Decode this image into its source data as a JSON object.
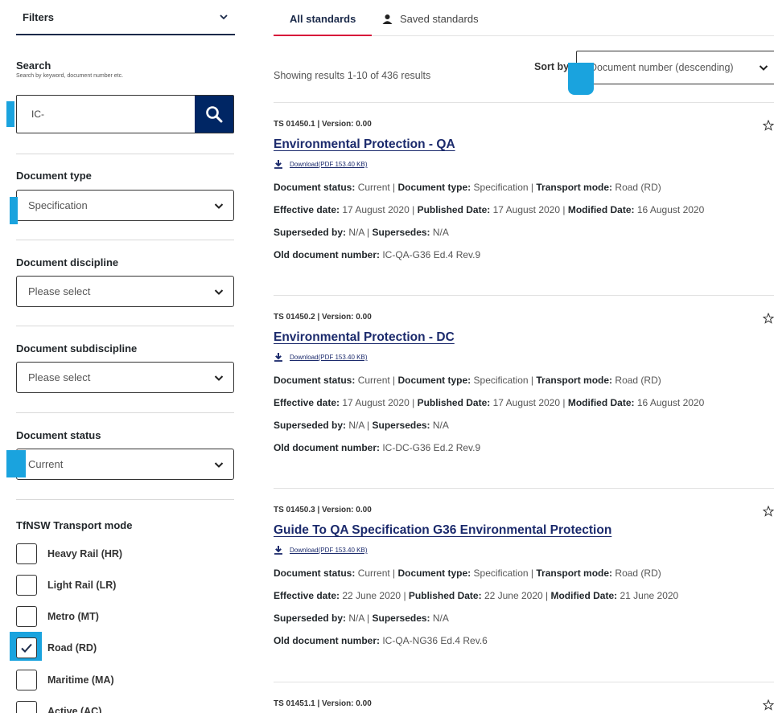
{
  "sidebar": {
    "filters_title": "Filters",
    "search": {
      "label": "Search",
      "hint": "Search by keyword, document number etc.",
      "value": "IC-"
    },
    "document_type": {
      "label": "Document type",
      "value": "Specification"
    },
    "document_discipline": {
      "label": "Document discipline",
      "value": "Please select"
    },
    "document_subdiscipline": {
      "label": "Document subdiscipline",
      "value": "Please select"
    },
    "document_status": {
      "label": "Document status",
      "value": "Current"
    },
    "transport_mode": {
      "label": "TfNSW Transport mode",
      "options": [
        {
          "label": "Heavy Rail (HR)",
          "checked": false
        },
        {
          "label": "Light Rail (LR)",
          "checked": false
        },
        {
          "label": "Metro (MT)",
          "checked": false
        },
        {
          "label": "Road (RD)",
          "checked": true
        },
        {
          "label": "Maritime (MA)",
          "checked": false
        },
        {
          "label": "Active (AC)",
          "checked": false
        }
      ]
    }
  },
  "main": {
    "tabs": [
      {
        "label": "All standards",
        "active": true
      },
      {
        "label": "Saved standards",
        "active": false
      }
    ],
    "showing": "Showing results 1-10 of 436 results",
    "sort_label": "Sort by",
    "sort_value": "Document number (descending)",
    "results": [
      {
        "version": "TS 01450.1 | Version: 0.00",
        "title": "Environmental Protection - QA",
        "download": "Download(PDF 153.40 KB)",
        "status": "Current",
        "type": "Specification",
        "mode": "Road (RD)",
        "effective": "17 August 2020",
        "published": "17 August 2020",
        "modified": "16 August 2020",
        "superseded_by": "N/A",
        "supersedes": "N/A",
        "old_number": "IC-QA-G36 Ed.4 Rev.9"
      },
      {
        "version": "TS 01450.2 | Version: 0.00",
        "title": "Environmental Protection - DC",
        "download": "Download(PDF 153.40 KB)",
        "status": "Current",
        "type": "Specification",
        "mode": "Road (RD)",
        "effective": "17 August 2020",
        "published": "17 August 2020",
        "modified": "16 August 2020",
        "superseded_by": "N/A",
        "supersedes": "N/A",
        "old_number": "IC-DC-G36 Ed.2 Rev.9"
      },
      {
        "version": "TS 01450.3 | Version: 0.00",
        "title": "Guide To QA Specification G36 Environmental Protection",
        "download": "Download(PDF 153.40 KB)",
        "status": "Current",
        "type": "Specification",
        "mode": "Road (RD)",
        "effective": "22 June 2020",
        "published": "22 June 2020",
        "modified": "21 June 2020",
        "superseded_by": "N/A",
        "supersedes": "N/A",
        "old_number": "IC-QA-NG36 Ed.4 Rev.6"
      },
      {
        "version": "TS 01451.1 | Version: 0.00"
      }
    ],
    "field_labels": {
      "status": "Document status:",
      "type": "Document type:",
      "mode": "Transport mode:",
      "effective": "Effective date:",
      "published": "Published Date:",
      "modified": "Modified Date:",
      "superseded_by": "Superseded by:",
      "supersedes": "Supersedes:",
      "old_number": "Old document number:"
    }
  },
  "colors": {
    "navy": "#002664",
    "accent_red": "#d7153a",
    "link": "#1b2a6c",
    "highlight": "#1aa3de"
  }
}
